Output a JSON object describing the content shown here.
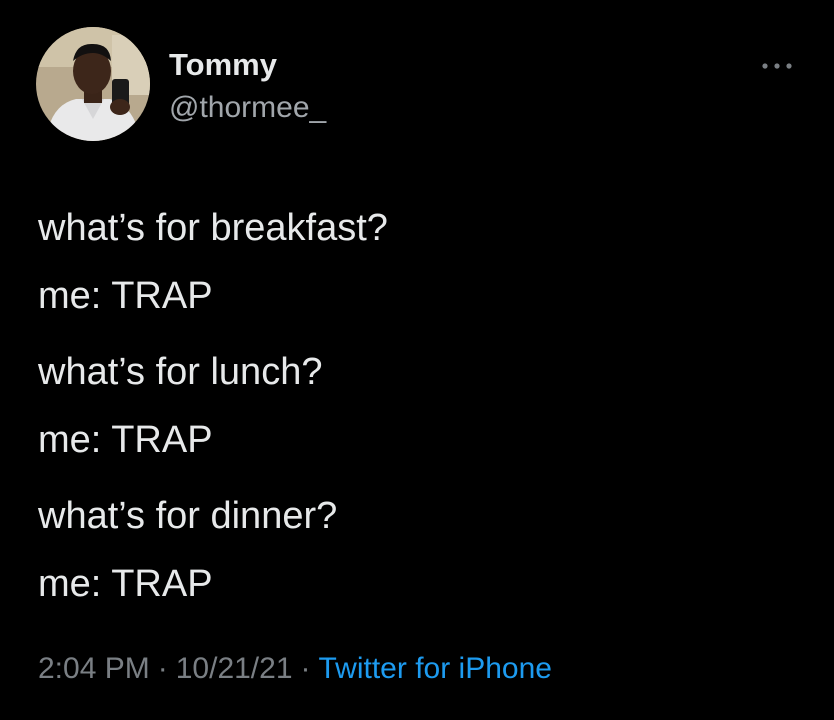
{
  "user": {
    "display_name": "Tommy",
    "handle": "@thormee_"
  },
  "tweet": {
    "paragraphs": [
      [
        "what’s for breakfast?",
        "me: TRAP"
      ],
      [
        "what’s for lunch?",
        "me: TRAP"
      ],
      [
        "what’s for dinner?",
        "me: TRAP"
      ]
    ]
  },
  "meta": {
    "time": "2:04 PM",
    "separator": "·",
    "date": "10/21/21",
    "source": "Twitter for iPhone"
  },
  "icons": {
    "more": "more-options-icon",
    "avatar": "user-avatar"
  },
  "colors": {
    "background": "#000000",
    "text": "#e7e9ea",
    "secondary": "#7a7f84",
    "link": "#1d9bf0"
  }
}
